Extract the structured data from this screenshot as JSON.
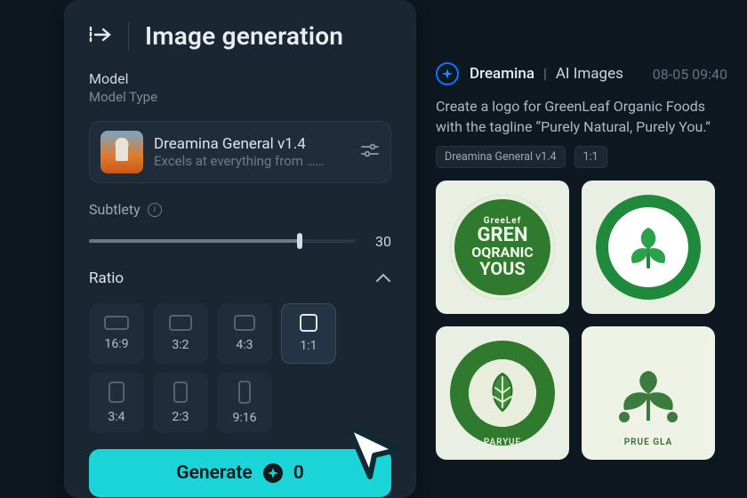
{
  "panel": {
    "title": "Image generation",
    "model_section": "Model",
    "model_type": "Model Type",
    "model": {
      "name": "Dreamina General v1.4",
      "desc": "Excels at everything from ……"
    },
    "subtlety_label": "Subtlety",
    "subtlety_value": "30",
    "ratio_label": "Ratio",
    "ratios": {
      "r0": "16:9",
      "r1": "3:2",
      "r2": "4:3",
      "r3": "1:1",
      "r4": "3:4",
      "r5": "2:3",
      "r6": "9:16"
    },
    "generate_label": "Generate",
    "generate_cost": "0"
  },
  "output": {
    "app": "Dreamina",
    "kind": "AI Images",
    "timestamp": "08-05  09:40",
    "prompt": "Create a logo for GreenLeaf Organic Foods with the tagline “Purely Natural, Purely You.”",
    "chips": {
      "c0": "Dreamina General v1.4",
      "c1": "1:1"
    },
    "tile1": {
      "l1": "GreeLef",
      "l2": "GREN",
      "l3": "OQRANIC",
      "l4": "YOUS"
    },
    "tile3_cap": "PARYUE",
    "tile4_cap": "PRUE   GLA"
  }
}
